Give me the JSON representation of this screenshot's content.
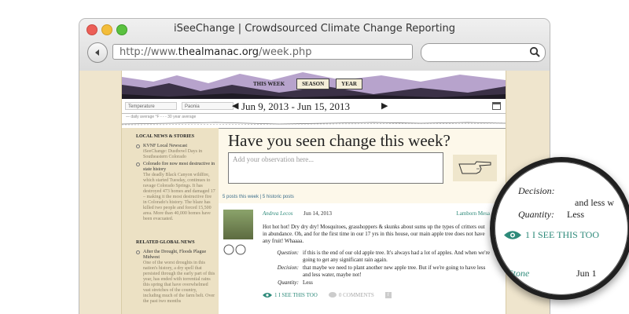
{
  "window": {
    "title": "iSeeChange | Crowdsourced Climate Change Reporting"
  },
  "url": {
    "prefix": "http://www.",
    "domain": "thealmanac.org",
    "path": "/week.php"
  },
  "site": {
    "nav": [
      {
        "label": "THIS WEEK"
      },
      {
        "label": "SEASON"
      },
      {
        "label": "YEAR"
      }
    ],
    "filters": {
      "metric": "Temperature",
      "location": "Paonia"
    },
    "date_range": "Jun 9, 2013 - Jun 15, 2013",
    "graph_legend": "— daily average °F    - - - 30 year average"
  },
  "sidebar": {
    "local_heading": "LOCAL NEWS & STORIES",
    "local_items": [
      {
        "title": "KVNF Local Newscast",
        "desc": "iSeeChange: Dustbowl Days in Southeastern Colorado"
      },
      {
        "title": "Colorado fire now most destructive in state history",
        "desc": "The deadly Black Canyon wildfire, which started Tuesday, continues to ravage Colorado Springs. It has destroyed 473 homes and damaged 17 – making it the most destructive fire in Colorado's history. The blaze has killed two people and forced 15,500 area. More than 40,000 homes have been evacuated."
      }
    ],
    "global_heading": "RELATED GLOBAL NEWS",
    "global_items": [
      {
        "title": "After the Drought, Floods Plague Midwest",
        "desc": "One of the worst droughts in this nation's history, a dry spell that persisted through the early part of this year, has ended with torrential rains this spring that have overwhelmed vast stretches of the country, including much of the farm belt. Over the past two months"
      }
    ]
  },
  "main": {
    "headline": "Have you seen change this week?",
    "observation_placeholder": "Add your observation here...",
    "post_links": "5 posts this week | 5 historic posts",
    "post": {
      "author": "Andrea Lecos",
      "date": "Jun 14, 2013",
      "location": "Lamborn Mesa",
      "body": "Hot hot hot! Dry dry dry! Mosquitoes, grasshoppers & skunks about sums up the types of critters out in abundance. Oh, and for the first time in our 17 yrs in this house, our main apple tree does not have any fruit! Whaaaa.",
      "question_label": "Question:",
      "question": "if this is the end of our old apple tree. It's always had a lot of apples. And when we're going to get any significant rain again.",
      "decision_label": "Decision:",
      "decision": "that maybe we need to plant another new apple tree. But if we're going to have less and less water, maybe not!",
      "quantity_label": "Quantity:",
      "quantity": "Less",
      "see_this_too": "1 I SEE THIS TOO",
      "comments": "0 COMMENTS"
    }
  },
  "magnifier": {
    "decision_label": "Decision:",
    "decision_tail": "and less w",
    "quantity_label": "Quantity:",
    "quantity": "Less",
    "see_this_too": "1 I SEE THIS TOO",
    "name_fragment": "lyn Stone",
    "date_fragment": "Jun 1"
  },
  "colors": {
    "accent": "#2e8a7a",
    "banner": "#b7a3cc",
    "paper": "#fdf8ea"
  }
}
